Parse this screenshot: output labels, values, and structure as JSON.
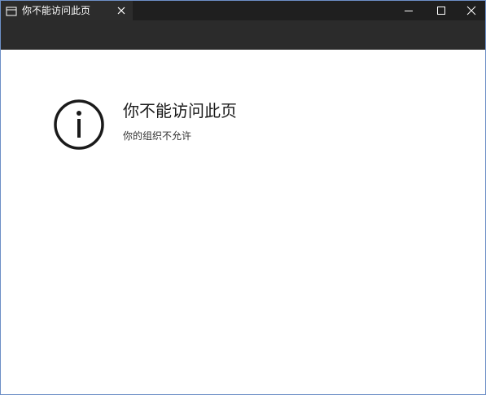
{
  "window": {
    "tab_title": "你不能访问此页",
    "tab_icon": "page-icon",
    "controls": [
      "minimize-icon",
      "maximize-icon",
      "close-icon"
    ]
  },
  "page": {
    "icon": "info-icon",
    "heading": "你不能访问此页",
    "subtext": "你的组织不允许"
  },
  "colors": {
    "titlebar": "#1f1f1f",
    "tab": "#2c2c2c",
    "toolbar": "#2b2b2b",
    "content": "#ffffff",
    "heading_text": "#1a1a1a"
  }
}
